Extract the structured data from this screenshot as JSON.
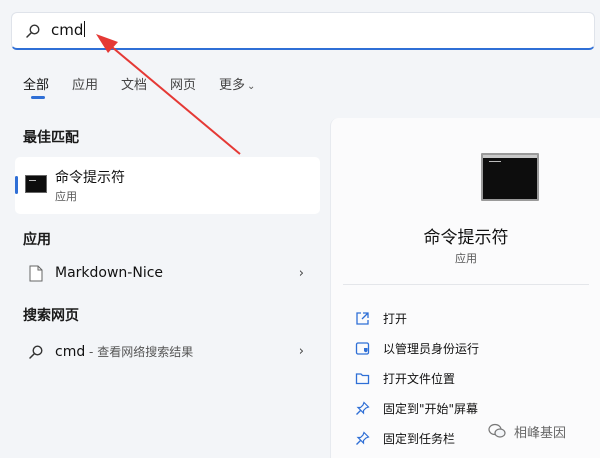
{
  "search": {
    "query": "cmd"
  },
  "tabs": [
    {
      "label": "全部"
    },
    {
      "label": "应用"
    },
    {
      "label": "文档"
    },
    {
      "label": "网页"
    },
    {
      "label": "更多"
    }
  ],
  "best_match": {
    "section": "最佳匹配",
    "name": "命令提示符",
    "type": "应用"
  },
  "apps": {
    "section": "应用",
    "items": [
      {
        "label": "Markdown-Nice"
      }
    ]
  },
  "web": {
    "section": "搜索网页",
    "items": [
      {
        "label": "cmd",
        "sub": " - 查看网络搜索结果"
      }
    ]
  },
  "detail": {
    "name": "命令提示符",
    "type": "应用",
    "actions": [
      {
        "label": "打开",
        "icon": "open-icon"
      },
      {
        "label": "以管理员身份运行",
        "icon": "admin-shield-icon"
      },
      {
        "label": "打开文件位置",
        "icon": "folder-icon"
      },
      {
        "label": "固定到\"开始\"屏幕",
        "icon": "pin-icon"
      },
      {
        "label": "固定到任务栏",
        "icon": "pin-icon"
      }
    ]
  },
  "watermark": {
    "text": "相峰基因"
  },
  "colors": {
    "accent": "#2f6fd6",
    "annotation_arrow": "#e53935"
  }
}
